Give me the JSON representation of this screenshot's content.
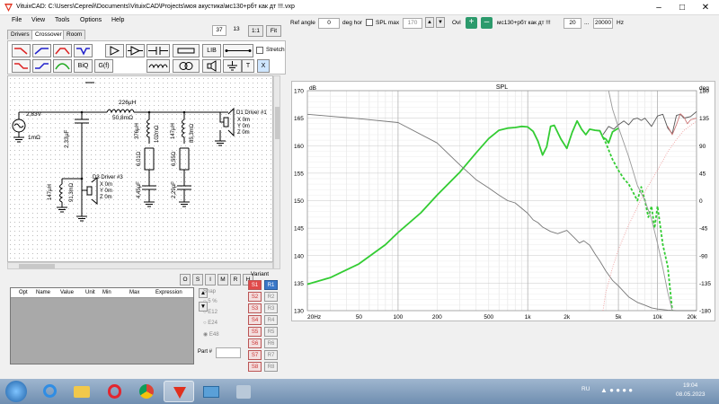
{
  "window": {
    "title": "VituixCAD: C:\\Users\\Сергей\\Documents\\VituixCAD\\Projects\\моя акустика\\мс130+рбт как дт !!!.vxp"
  },
  "menu": [
    "File",
    "View",
    "Tools",
    "Options",
    "Help"
  ],
  "toolbar": {
    "ref_angle_label": "Ref angle",
    "ref_angle_value": "0",
    "deg_hor_label": "deg hor",
    "spl_max_label": "SPL max",
    "spl_max_value": "170",
    "ovl_label": "Ovl",
    "variant_name": "мс130+рбт как дт !!!",
    "freq_min": "20",
    "freq_sep": "...",
    "freq_max": "20000",
    "hz_label": "Hz"
  },
  "left": {
    "zoom_value1": "37",
    "zoom_value2": "13",
    "zoom_11": "1:1",
    "zoom_fit": "Fit",
    "tabs": [
      "Drivers",
      "Crossover",
      "Room"
    ],
    "palette_labels": [
      "BiQ",
      "G(f)",
      "LIB",
      "T",
      "X"
    ],
    "stretch_label": "Stretch"
  },
  "circuit": {
    "source_v": "2,83V",
    "source_r": "1mΩ",
    "series_l": "226µH",
    "series_l_r": "50,8mΩ",
    "c1": "2,33µF",
    "branch2": [
      "376µH",
      "102mΩ",
      "6,01Ω",
      "4,45µF"
    ],
    "branch3": [
      "147µH",
      "85,3mΩ",
      "6,55Ω",
      "2,29µF"
    ],
    "driver1": {
      "name": "D1 Driver #1",
      "x": "X 0m",
      "y": "Y 0m",
      "z": "Z 0m"
    },
    "driver3": {
      "name": "D3 Driver #3",
      "x": "X 0m",
      "y": "Y 0m",
      "z": "Z 0m"
    },
    "l3": "147µH",
    "l3_r": "91,3mΩ"
  },
  "param_buttons": [
    "O",
    "S",
    "I",
    "M",
    "R",
    "H"
  ],
  "param_table": {
    "columns": [
      "Opt",
      "Name",
      "Value",
      "Unit",
      "Min",
      "Max",
      "Expression"
    ]
  },
  "snap": {
    "label": "Snap",
    "options": [
      "5 %",
      "E12",
      "E24",
      "E48"
    ],
    "selected": "E48"
  },
  "part_label": "Part #",
  "variant": {
    "label": "Variant",
    "s": [
      "S1",
      "S2",
      "S3",
      "S4",
      "S5",
      "S6",
      "S7",
      "S8"
    ],
    "r": [
      "R1",
      "R2",
      "R3",
      "R4",
      "R5",
      "R6",
      "R7",
      "R8"
    ]
  },
  "chart_data": {
    "type": "line",
    "title": "SPL",
    "ylabel_left": "dB",
    "ylabel_right": "deg",
    "ylim_left": [
      130,
      170
    ],
    "ylim_right": [
      -180,
      180
    ],
    "yticks_left": [
      "170",
      "165",
      "160",
      "155",
      "150",
      "145",
      "140",
      "135",
      "130"
    ],
    "yticks_right": [
      "180",
      "135",
      "90",
      "45",
      "0",
      "-45",
      "-90",
      "-135",
      "-180"
    ],
    "xscale": "log",
    "xlim": [
      20,
      20000
    ],
    "xticks": [
      "20Hz",
      "50",
      "100",
      "200",
      "500",
      "1k",
      "2k",
      "5k",
      "10k",
      "20k"
    ],
    "xtick_values": [
      20,
      50,
      100,
      200,
      500,
      1000,
      2000,
      5000,
      10000,
      20000
    ],
    "grid": true,
    "series": [
      {
        "color": "#33cc33",
        "style": "solid",
        "x": [
          20,
          30,
          50,
          80,
          100,
          150,
          200,
          300,
          400,
          500,
          600,
          700,
          800,
          900,
          1000,
          1100,
          1200,
          1300,
          1400,
          1500,
          1600,
          1800,
          2000,
          2200,
          2400,
          2600,
          2800,
          3000,
          3300,
          3600,
          3800,
          4000,
          4200,
          4500,
          5000
        ],
        "y": [
          134.8,
          136,
          138.5,
          142,
          144.2,
          147.8,
          151,
          155.2,
          158.7,
          161.3,
          162.8,
          163.2,
          163.3,
          163.5,
          163.4,
          162.6,
          160.8,
          158.3,
          159.8,
          163.5,
          163.7,
          161.2,
          159.5,
          162.4,
          164.5,
          163,
          162,
          163,
          162.8,
          162.7,
          161.5,
          161.2,
          160.5,
          162.5,
          163.2
        ]
      },
      {
        "color": "#33cc33",
        "style": "dashed",
        "x": [
          3800,
          4000,
          4500,
          5000,
          5500,
          6000,
          6500,
          7000,
          7500,
          8000,
          8500,
          9000,
          9500,
          10000,
          11000,
          12000,
          13000
        ],
        "y": [
          161.5,
          160.5,
          157.5,
          155.5,
          154,
          153,
          151.5,
          150,
          152.5,
          150,
          147,
          149,
          145,
          149,
          142,
          138,
          130
        ]
      },
      {
        "color": "#777777",
        "style": "solid",
        "x": [
          20,
          50,
          100,
          200,
          300,
          400,
          500,
          600,
          700,
          800,
          1000,
          1100,
          1200,
          1300,
          1500,
          1700,
          2000,
          2300,
          2500,
          2700,
          3000,
          3300,
          3600,
          4000,
          4500,
          5000,
          6000,
          7000,
          8000,
          9000,
          10000,
          12000,
          14000,
          16000,
          18000,
          20000
        ],
        "y": [
          165.7,
          164.9,
          164.2,
          160.5,
          156.5,
          153.8,
          152.3,
          151,
          150,
          149.6,
          147.7,
          146.5,
          146,
          145.2,
          144.4,
          144,
          144.6,
          143.2,
          142.3,
          142.7,
          141.9,
          140.3,
          139,
          137.2,
          135.5,
          134.5,
          132.5,
          131.5,
          131,
          130.5,
          130.3,
          130.1,
          130,
          130,
          130,
          130
        ]
      },
      {
        "color": "#555555",
        "style": "solid",
        "x": [
          3800,
          4200,
          4600,
          5000,
          5500,
          6000,
          6500,
          7000,
          7500,
          8000,
          9000,
          10000,
          11000,
          12000,
          13000,
          14000,
          15000,
          16000,
          18000,
          20000
        ],
        "y": [
          162,
          163.5,
          163,
          163.8,
          164.5,
          163.8,
          164.8,
          165,
          164.6,
          165,
          163.5,
          165.4,
          165.7,
          163.2,
          162.2,
          165.5,
          165.7,
          165,
          165.3,
          166.2
        ]
      },
      {
        "color": "#cc7777",
        "style": "solid",
        "x": [
          12000,
          13000,
          14000,
          15000,
          16000,
          17000,
          18000,
          20000
        ],
        "y": [
          163.5,
          162,
          163.8,
          165.8,
          165.2,
          164,
          164.7,
          165
        ]
      },
      {
        "color": "#999999",
        "style": "solid",
        "axis": "right",
        "x": [
          4200,
          4500,
          5000,
          6000,
          7000,
          8000,
          9000,
          10000,
          11000,
          12000,
          13000
        ],
        "y": [
          180,
          150,
          120,
          72,
          25,
          0,
          -30,
          -70,
          -110,
          -150,
          -180
        ]
      },
      {
        "color": "#f0a0a0",
        "style": "dotted",
        "axis": "right",
        "x": [
          3800,
          4000,
          4500,
          5000,
          6000,
          7000,
          8000,
          10000,
          12000,
          14000,
          16000,
          20000
        ],
        "y": [
          -180,
          -150,
          -110,
          -80,
          -40,
          -10,
          15,
          50,
          80,
          100,
          115,
          130
        ]
      }
    ]
  }
}
